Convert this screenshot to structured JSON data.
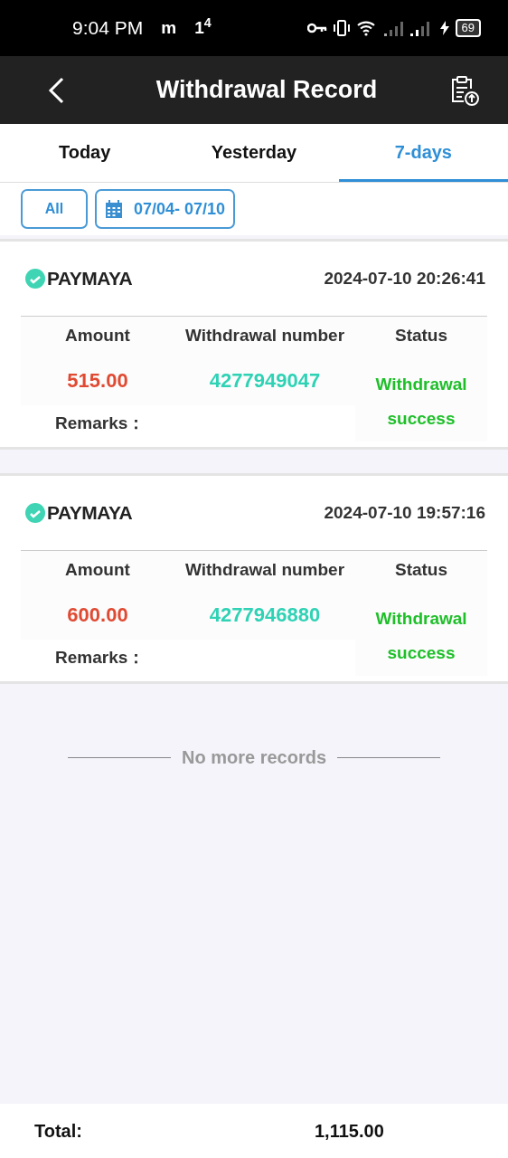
{
  "status_bar": {
    "time": "9:04 PM",
    "notifications": [
      "m",
      "1$^{4}$"
    ],
    "battery": "69"
  },
  "header": {
    "title": "Withdrawal Record"
  },
  "tabs": [
    {
      "label": "Today",
      "selected": false
    },
    {
      "label": "Yesterday",
      "selected": false
    },
    {
      "label": "7-days",
      "selected": true
    }
  ],
  "filters": {
    "all": "All",
    "date_range": "07/04- 07/10"
  },
  "records": [
    {
      "method": "PAYMAYA",
      "time": "2024-07-10 20:26:41",
      "columns": [
        "Amount",
        "Withdrawal number",
        "Status"
      ],
      "amount": "515.00",
      "number": "4277949047",
      "status": "Withdrawal success",
      "remarks_label": "Remarks："
    },
    {
      "method": "PAYMAYA",
      "time": "2024-07-10 19:57:16",
      "columns": [
        "Amount",
        "Withdrawal number",
        "Status"
      ],
      "amount": "600.00",
      "number": "4277946880",
      "status": "Withdrawal success",
      "remarks_label": "Remarks："
    }
  ],
  "end_note": "No more records",
  "footer": {
    "label": "Total:",
    "value": "1,115.00"
  }
}
